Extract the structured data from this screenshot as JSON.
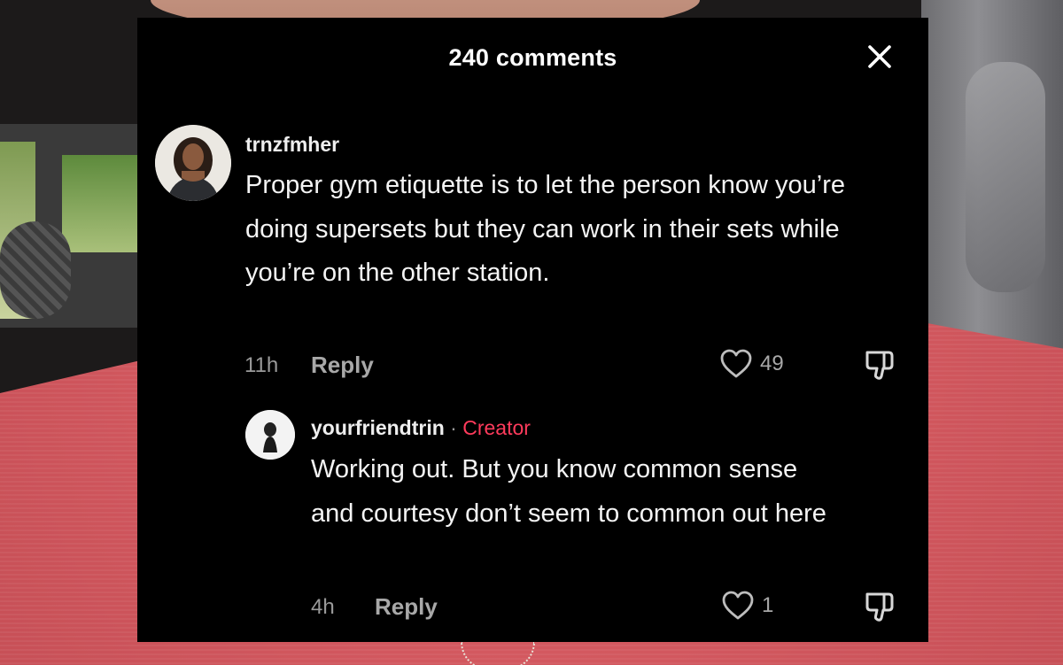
{
  "panel": {
    "title": "240 comments",
    "close_icon": "close-icon"
  },
  "comments": [
    {
      "username": "trnzfmher",
      "text": "Proper gym etiquette is to let the person know you’re doing supersets but they can work in their sets while you’re on the other station.",
      "time": "11h",
      "reply_label": "Reply",
      "likes": "49"
    },
    {
      "username": "yourfriendtrin",
      "separator": "·",
      "badge": "Creator",
      "text": "Working out. But you know common sense and courtesy don’t seem to common out here",
      "time": "4h",
      "reply_label": "Reply",
      "likes": "1"
    }
  ],
  "colors": {
    "panel_bg": "#000000",
    "creator_badge": "#ff3b5c",
    "muted_text": "#a8a8a8"
  }
}
